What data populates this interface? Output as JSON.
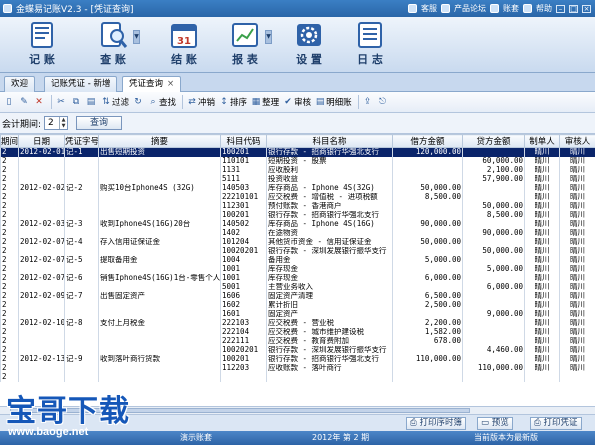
{
  "app": {
    "title": "金蝶易记账V2.3 - [凭证查询]",
    "links": [
      "客服",
      "产品论坛",
      "账套",
      "帮助"
    ]
  },
  "ribbon": [
    {
      "label": "记 账",
      "icon": "bookkeeping-icon",
      "dropdown": false
    },
    {
      "label": "查 账",
      "icon": "query-icon",
      "dropdown": true
    },
    {
      "label": "结 账",
      "icon": "calendar-icon",
      "dropdown": false
    },
    {
      "label": "报 表",
      "icon": "report-icon",
      "dropdown": true
    },
    {
      "label": "设 置",
      "icon": "gear-icon",
      "dropdown": false
    },
    {
      "label": "日 志",
      "icon": "log-icon",
      "dropdown": false
    }
  ],
  "tabs": [
    {
      "label": "欢迎",
      "active": false,
      "closable": false
    },
    {
      "label": "记账凭证 - 新增",
      "active": false,
      "closable": false
    },
    {
      "label": "凭证查询",
      "active": true,
      "closable": true
    }
  ],
  "toolbar": {
    "filter": "过滤",
    "find": "查找",
    "reverse": "冲销",
    "sort": "排序",
    "organize": "整理",
    "audit": "审核",
    "detail": "明细账"
  },
  "filter": {
    "label": "会计期间:",
    "period": "2",
    "query_button": "查询"
  },
  "table": {
    "columns": [
      "期间",
      "日期",
      "凭证字号",
      "摘要",
      "科目代码",
      "科目名称",
      "借方金额",
      "贷方金额",
      "制单人",
      "审核人"
    ],
    "rows": [
      [
        "2",
        "2012-02-01",
        "记-1",
        "出售短期投资",
        "100201",
        "银行存款 - 招商银行华强北支行",
        "120,000.00",
        "",
        "晴川",
        "晴川"
      ],
      [
        "2",
        "",
        "",
        "",
        "110101",
        "短期投资 - 股票",
        "",
        "60,000.00",
        "晴川",
        "晴川"
      ],
      [
        "2",
        "",
        "",
        "",
        "1131",
        "应收股利",
        "",
        "2,100.00",
        "晴川",
        "晴川"
      ],
      [
        "2",
        "",
        "",
        "",
        "5111",
        "投资收益",
        "",
        "57,900.00",
        "晴川",
        "晴川"
      ],
      [
        "2",
        "2012-02-02",
        "记-2",
        "购买10台Iphone4S (32G)",
        "140503",
        "库存商品 - Iphone 4S(32G)",
        "50,000.00",
        "",
        "晴川",
        "晴川"
      ],
      [
        "2",
        "",
        "",
        "",
        "22210101",
        "应交税费 - 增值税 - 进项税额",
        "8,500.00",
        "",
        "晴川",
        "晴川"
      ],
      [
        "2",
        "",
        "",
        "",
        "112301",
        "预付账款 - 香港商户",
        "",
        "50,000.00",
        "晴川",
        "晴川"
      ],
      [
        "2",
        "",
        "",
        "",
        "100201",
        "银行存款 - 招商银行华强北支行",
        "",
        "8,500.00",
        "晴川",
        "晴川"
      ],
      [
        "2",
        "2012-02-03",
        "记-3",
        "收到Iphone4S(16G)20台",
        "140502",
        "库存商品 - Iphone 4S(16G)",
        "90,000.00",
        "",
        "晴川",
        "晴川"
      ],
      [
        "2",
        "",
        "",
        "",
        "1402",
        "在途物资",
        "",
        "90,000.00",
        "晴川",
        "晴川"
      ],
      [
        "2",
        "2012-02-07",
        "记-4",
        "存入信用证保证金",
        "101204",
        "其他货币资金 - 信用证保证金",
        "50,000.00",
        "",
        "晴川",
        "晴川"
      ],
      [
        "2",
        "",
        "",
        "",
        "10020201",
        "银行存款 - 深圳发展银行振华支行",
        "",
        "50,000.00",
        "晴川",
        "晴川"
      ],
      [
        "2",
        "2012-02-07",
        "记-5",
        "提取备用金",
        "1004",
        "备用金",
        "5,000.00",
        "",
        "晴川",
        "晴川"
      ],
      [
        "2",
        "",
        "",
        "",
        "1001",
        "库存现金",
        "",
        "5,000.00",
        "晴川",
        "晴川"
      ],
      [
        "2",
        "2012-02-07",
        "记-6",
        "销售Iphone4S(16G)1台-零售个人",
        "1001",
        "库存现金",
        "6,000.00",
        "",
        "晴川",
        "晴川"
      ],
      [
        "2",
        "",
        "",
        "",
        "5001",
        "主营业务收入",
        "",
        "6,000.00",
        "晴川",
        "晴川"
      ],
      [
        "2",
        "2012-02-09",
        "记-7",
        "出售固定资产",
        "1606",
        "固定资产清理",
        "6,500.00",
        "",
        "晴川",
        "晴川"
      ],
      [
        "2",
        "",
        "",
        "",
        "1602",
        "累计折旧",
        "2,500.00",
        "",
        "晴川",
        "晴川"
      ],
      [
        "2",
        "",
        "",
        "",
        "1601",
        "固定资产",
        "",
        "9,000.00",
        "晴川",
        "晴川"
      ],
      [
        "2",
        "2012-02-10",
        "记-8",
        "支付上月税金",
        "222103",
        "应交税费 - 营业税",
        "2,200.00",
        "",
        "晴川",
        "晴川"
      ],
      [
        "2",
        "",
        "",
        "",
        "222104",
        "应交税费 - 城市维护建设税",
        "1,582.00",
        "",
        "晴川",
        "晴川"
      ],
      [
        "2",
        "",
        "",
        "",
        "222111",
        "应交税费 - 教育费附加",
        "678.00",
        "",
        "晴川",
        "晴川"
      ],
      [
        "2",
        "",
        "",
        "",
        "10020201",
        "银行存款 - 深圳发展银行振华支行",
        "",
        "4,460.00",
        "晴川",
        "晴川"
      ],
      [
        "2",
        "2012-02-13",
        "记-9",
        "收到落叶商行货款",
        "100201",
        "银行存款 - 招商银行华强北支行",
        "110,000.00",
        "",
        "晴川",
        "晴川"
      ],
      [
        "2",
        "",
        "",
        "",
        "112203",
        "应收账款 - 落叶商行",
        "",
        "110,000.00",
        "晴川",
        "晴川"
      ],
      [
        "2",
        "",
        "",
        "",
        "",
        "",
        "",
        "",
        "",
        ""
      ]
    ]
  },
  "bottom": {
    "print_preview": "打印序时簿",
    "preview": "预览",
    "print_voucher": "打印凭证"
  },
  "status": {
    "account": "演示账套",
    "period": "2012年 第 2 期",
    "version": "当前版本为最新版"
  },
  "watermark": {
    "text": "宝哥下载",
    "url": "www.baoge.net"
  }
}
